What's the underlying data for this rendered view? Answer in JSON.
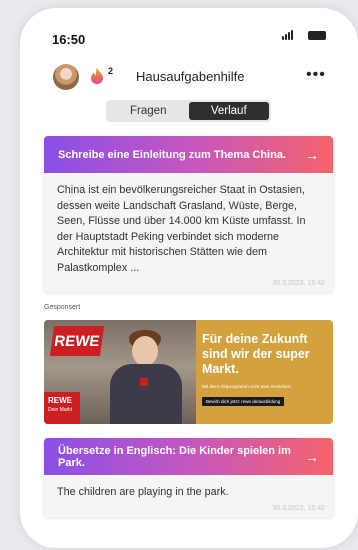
{
  "status": {
    "time": "16:50"
  },
  "header": {
    "flame_count": "2",
    "title": "Hausaufgabenhilfe",
    "more_label": "•••"
  },
  "tabs": [
    {
      "label": "Fragen",
      "active": false
    },
    {
      "label": "Verlauf",
      "active": true
    }
  ],
  "cards": [
    {
      "title": "Schreibe eine Einleitung zum Thema China.",
      "arrow": "→",
      "body": "China ist ein bevölkerungsreicher Staat in Ostasien, dessen weite Landschaft Grasland, Wüste, Berge, Seen, Flüsse und über 14.000 km Küste umfasst. In der Hauptstadt Peking verbindet sich moderne Architektur mit historischen Stätten wie dem Palastkomplex ...",
      "date": "30.3.2023, 15:42"
    },
    {
      "title": "Übersetze in Englisch: Die Kinder spielen im Park.",
      "arrow": "→",
      "body": "The children are playing in the park.",
      "date": "30.3.2023, 15:42"
    }
  ],
  "sponsored": {
    "label": "Gesponsert",
    "ad": {
      "sign": "REWE",
      "logo_name": "REWE",
      "logo_tagline": "Dein Markt",
      "headline": "Für deine Zukunft sind wir der super Markt.",
      "sub": "Mit dem Abiprogramm echt was erreichen.",
      "cta": "Bewirb dich jetzt: rewe.de/ausbildung"
    }
  },
  "colors": {
    "gradient_start": "#8a4fe6",
    "gradient_end": "#f4636b",
    "ad_background": "#d3a13d",
    "rewe_red": "#cc1f22"
  }
}
